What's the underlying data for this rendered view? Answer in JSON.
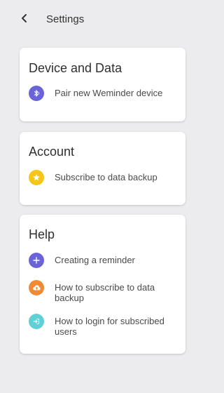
{
  "header": {
    "title": "Settings",
    "back_icon": "chevron-left-icon"
  },
  "sections": [
    {
      "title": "Device and Data",
      "items": [
        {
          "label": "Pair new Weminder device",
          "icon": "bluetooth-icon",
          "icon_color": "#6b63d8"
        }
      ]
    },
    {
      "title": "Account",
      "items": [
        {
          "label": "Subscribe to data backup",
          "icon": "star-icon",
          "icon_color": "#f5c518"
        }
      ]
    },
    {
      "title": "Help",
      "items": [
        {
          "label": "Creating a reminder",
          "icon": "plus-icon",
          "icon_color": "#6b63d8"
        },
        {
          "label": "How to subscribe to data backup",
          "icon": "cloud-upload-icon",
          "icon_color": "#f08a33"
        },
        {
          "label": "How to login for subscribed users",
          "icon": "login-icon",
          "icon_color": "#5fd0d6"
        }
      ]
    }
  ],
  "colors": {
    "background": "#ececee",
    "card": "#ffffff",
    "text_primary": "#2f2f2f",
    "text_secondary": "#4a4a4a"
  }
}
